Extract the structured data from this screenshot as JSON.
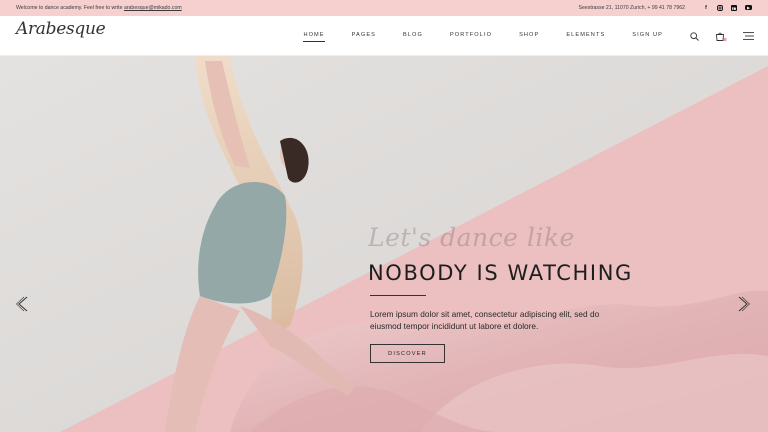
{
  "topbar": {
    "welcome_text": "Welcome to dance academy. Feel free to write ",
    "email": "arabesque@mikado.com",
    "address": "Seestrasse 21, 11070 Zurich, + 99 41 78 7962",
    "socials": [
      "facebook-icon",
      "instagram-icon",
      "linkedin-icon",
      "youtube-icon"
    ]
  },
  "header": {
    "logo": "Arabesque",
    "nav": [
      {
        "label": "HOME",
        "active": true
      },
      {
        "label": "PAGES"
      },
      {
        "label": "BLOG"
      },
      {
        "label": "PORTFOLIO"
      },
      {
        "label": "SHOP"
      },
      {
        "label": "ELEMENTS"
      },
      {
        "label": "SIGN UP"
      }
    ],
    "icons": [
      "search-icon",
      "cart-icon",
      "menu-icon"
    ],
    "cart_count": "0"
  },
  "hero": {
    "script_text": "Let's dance like",
    "headline": "NOBODY IS WATCHING",
    "body": "Lorem ipsum dolor sit amet, consectetur adipiscing elit, sed do eiusmod tempor incididunt ut labore et dolore.",
    "button": "DISCOVER",
    "colors": {
      "grey": "#d9d7d5",
      "pink": "#eab8b9",
      "fabric": "#e9c3c4"
    }
  }
}
